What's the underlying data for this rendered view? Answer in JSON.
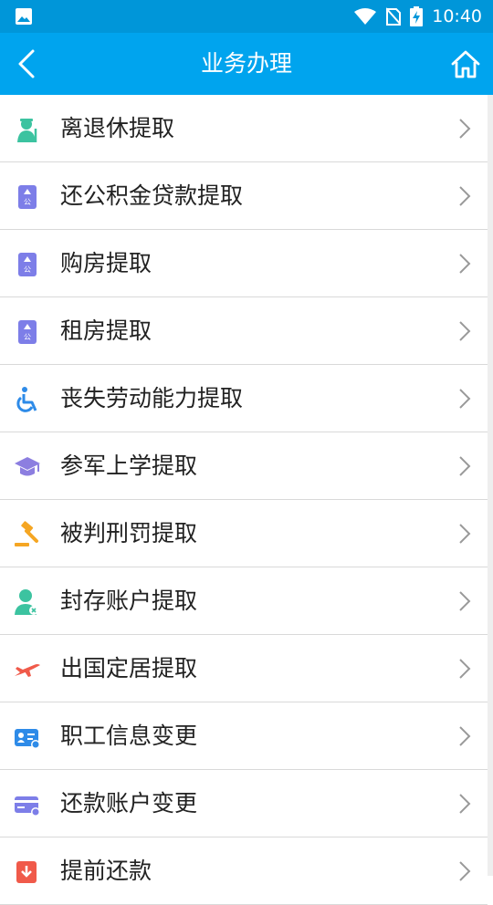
{
  "status_bar": {
    "time": "10:40"
  },
  "header": {
    "title": "业务办理"
  },
  "colors": {
    "status_bar": "#0096d9",
    "header": "#00a4ee",
    "chevron": "#999999"
  },
  "items": [
    {
      "label": "离退休提取",
      "icon": "retiree-icon"
    },
    {
      "label": "还公积金贷款提取",
      "icon": "fund-badge-icon"
    },
    {
      "label": "购房提取",
      "icon": "fund-badge-icon"
    },
    {
      "label": "租房提取",
      "icon": "fund-badge-icon"
    },
    {
      "label": "丧失劳动能力提取",
      "icon": "wheelchair-icon"
    },
    {
      "label": "参军上学提取",
      "icon": "graduation-cap-icon"
    },
    {
      "label": "被判刑罚提取",
      "icon": "gavel-icon"
    },
    {
      "label": "封存账户提取",
      "icon": "user-frozen-icon"
    },
    {
      "label": "出国定居提取",
      "icon": "airplane-icon"
    },
    {
      "label": "职工信息变更",
      "icon": "id-card-icon"
    },
    {
      "label": "还款账户变更",
      "icon": "bank-card-icon"
    },
    {
      "label": "提前还款",
      "icon": "early-repay-icon"
    }
  ]
}
